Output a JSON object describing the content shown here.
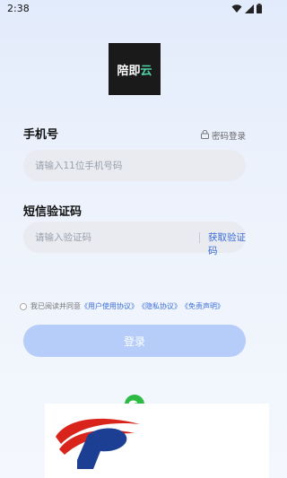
{
  "status_bar": {
    "time": "2:38",
    "icons": [
      "wifi-icon",
      "signal-icon",
      "battery-icon"
    ]
  },
  "logo": {
    "text_main": "陪即",
    "text_accent": "云",
    "accent_color": "#4fd1a5"
  },
  "phone": {
    "label": "手机号",
    "placeholder": "请输入11位手机号码"
  },
  "password_login": {
    "label": "密码登录",
    "icon": "lock-icon"
  },
  "code": {
    "label": "短信验证码",
    "placeholder": "请输入验证码",
    "get_code": "获取验证码"
  },
  "agreement": {
    "prefix": "我已阅读并同意",
    "user_agreement": "《用户使用协议》",
    "privacy": "《隐私协议》",
    "disclaimer": "《免责声明》"
  },
  "login_button": {
    "label": "登录"
  },
  "colors": {
    "primary": "#3b6fdc",
    "button_disabled": "#b5cdf8",
    "wechat": "#2dbb46",
    "overlay_red": "#d9241c",
    "overlay_blue": "#1c3f94"
  }
}
